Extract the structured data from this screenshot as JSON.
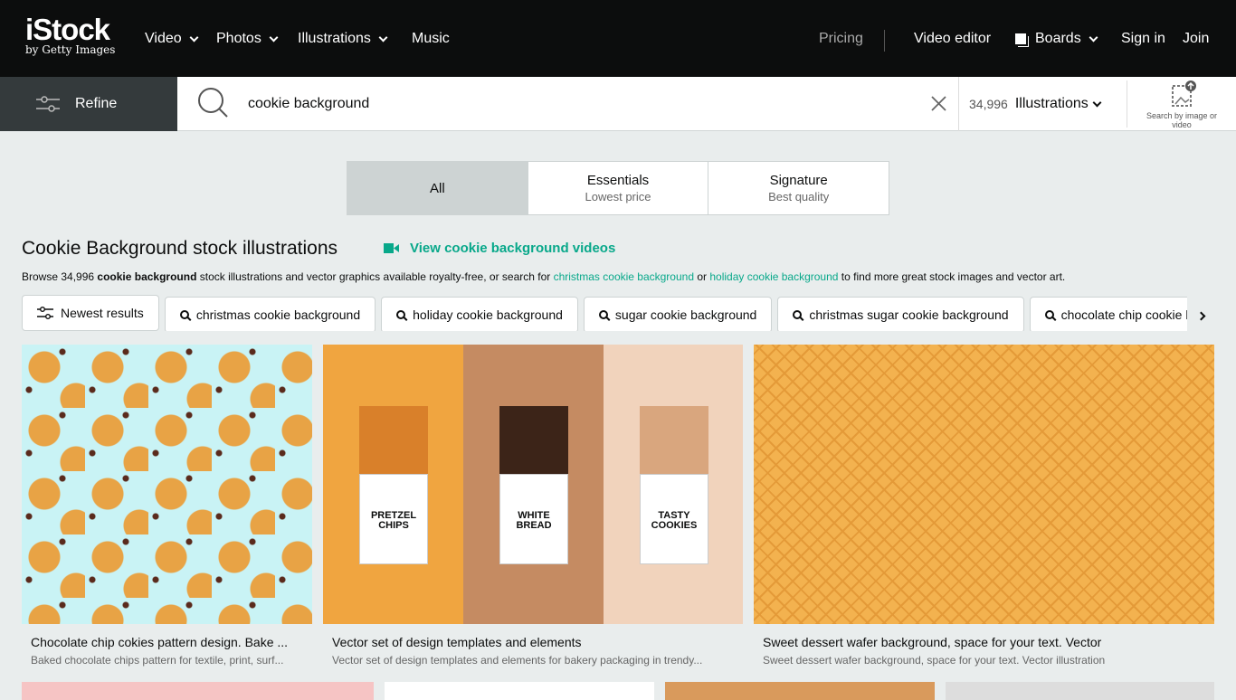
{
  "header": {
    "logo": "iStock",
    "logo_sub": "by Getty Images",
    "nav": [
      "Video",
      "Photos",
      "Illustrations",
      "Music"
    ],
    "pricing": "Pricing",
    "video_editor": "Video editor",
    "boards": "Boards",
    "sign_in": "Sign in",
    "join": "Join"
  },
  "search": {
    "refine": "Refine",
    "query": "cookie background",
    "count": "34,996",
    "type": "Illustrations",
    "by_image": "Search by image or video"
  },
  "tabs": [
    {
      "label": "All"
    },
    {
      "label": "Essentials",
      "sub": "Lowest price"
    },
    {
      "label": "Signature",
      "sub": "Best quality"
    }
  ],
  "title": "Cookie Background stock illustrations",
  "video_link": "View cookie background videos",
  "browse": {
    "pre": "Browse 34,996 ",
    "bold": "cookie background",
    "mid": " stock illustrations and vector graphics available royalty-free, or search for ",
    "link1": "christmas cookie background",
    "or": " or ",
    "link2": "holiday cookie background",
    "post": " to find more great stock images and vector art."
  },
  "chips": [
    "Newest results",
    "christmas cookie background",
    "holiday cookie background",
    "sugar cookie background",
    "christmas sugar cookie background",
    "chocolate chip cookie background"
  ],
  "results": [
    {
      "title": "Chocolate chip cokies pattern design. Bake ...",
      "desc": "Baked chocolate chips pattern for textile, print, surf..."
    },
    {
      "title": "Vector set of design templates and elements",
      "desc": "Vector set of design templates and elements for bakery packaging in trendy...",
      "labels": [
        "PRETZEL CHIPS",
        "WHITE BREAD",
        "TASTY COOKIES"
      ]
    },
    {
      "title": "Sweet dessert wafer background, space for your text. Vector",
      "desc": "Sweet dessert wafer background, space for your text. Vector illustration"
    }
  ],
  "colors": {
    "accent": "#08a88a",
    "header": "#0c0d0d"
  }
}
